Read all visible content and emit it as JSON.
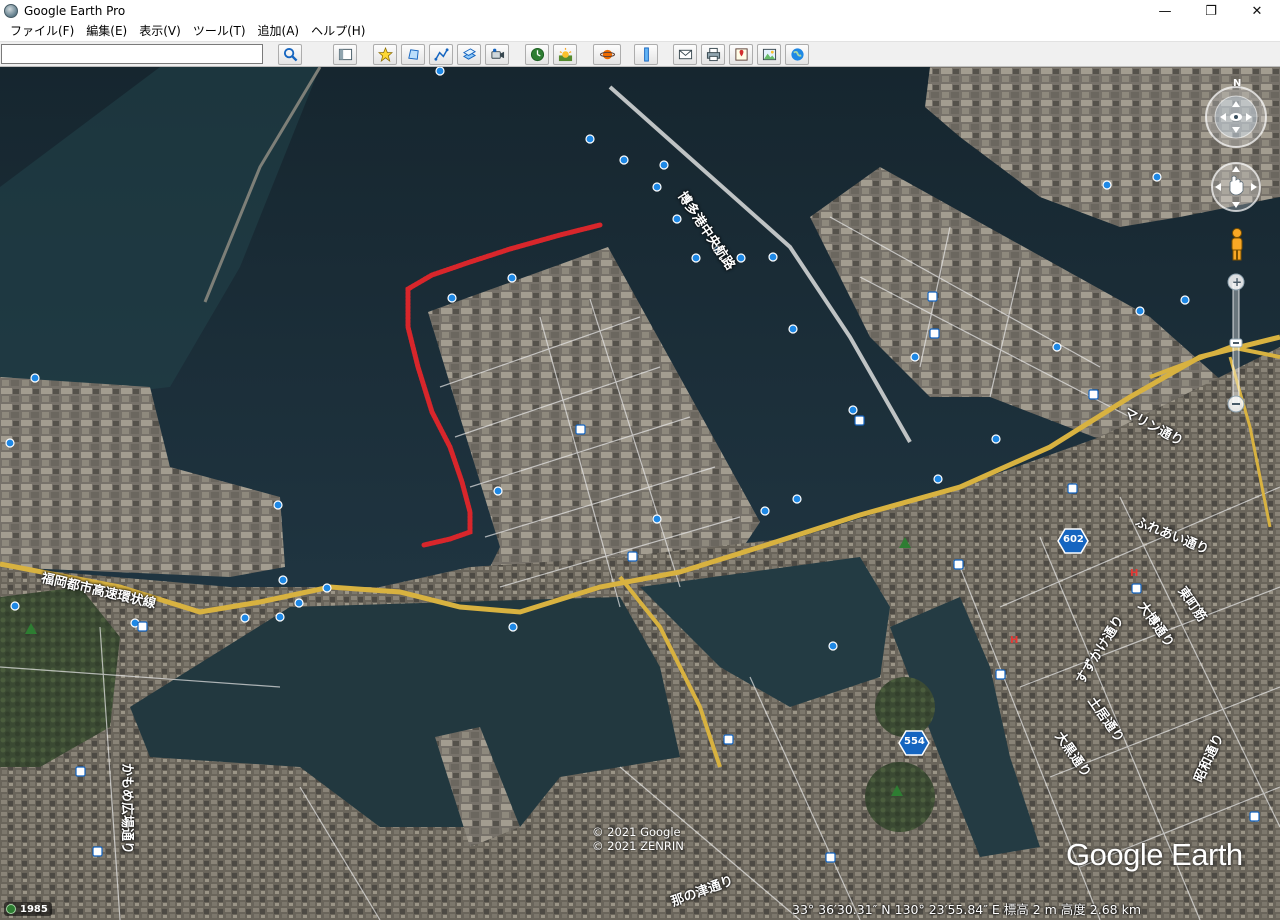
{
  "window": {
    "title": "Google Earth Pro",
    "controls": [
      "—",
      "❐",
      "✕"
    ]
  },
  "menu": [
    "ファイル(F)",
    "編集(E)",
    "表示(V)",
    "ツール(T)",
    "追加(A)",
    "ヘルプ(H)"
  ],
  "search": {
    "value": "",
    "placeholder": ""
  },
  "toolbar": {
    "buttons": [
      "search-icon",
      "sidebar-icon",
      "placemark-icon",
      "polygon-icon",
      "path-icon",
      "overlay-icon",
      "tour-icon",
      "historical-imagery-icon",
      "sunlight-icon",
      "planets-icon",
      "ruler-icon",
      "email-icon",
      "print-icon",
      "google-maps-icon",
      "save-image-icon",
      "earth-gallery-icon"
    ]
  },
  "map": {
    "labels": {
      "bridge": "博多港中央航路",
      "highway": "福岡都市高速環状線",
      "kamome": "かもめ広場通り",
      "road_right1": "ふれあい通り",
      "road_right2": "大博通り",
      "road_right3": "土居通り",
      "road_right4": "大黒通り",
      "road_right5": "昭和通り",
      "road_right6": "すずかけ通り",
      "road_right7": "マリン通り",
      "road_right8": "東町筋",
      "road_center": "那の津通り",
      "route_602": "602",
      "route_554": "554"
    }
  },
  "status": {
    "copyright1": "© 2021 Google",
    "copyright2": "© 2021 ZENRIN",
    "logo": "Google Earth",
    "coords": "33° 36′30.31″ N  130° 23′55.84″ E  標高    2 m    高度   2.68 km",
    "year": "1985"
  },
  "colors": {
    "water": "#1d2f3a",
    "land": "#5e5a52",
    "road_yellow": "#d8b240",
    "road_white": "#e8e8e8",
    "path_red": "#d8262b"
  }
}
